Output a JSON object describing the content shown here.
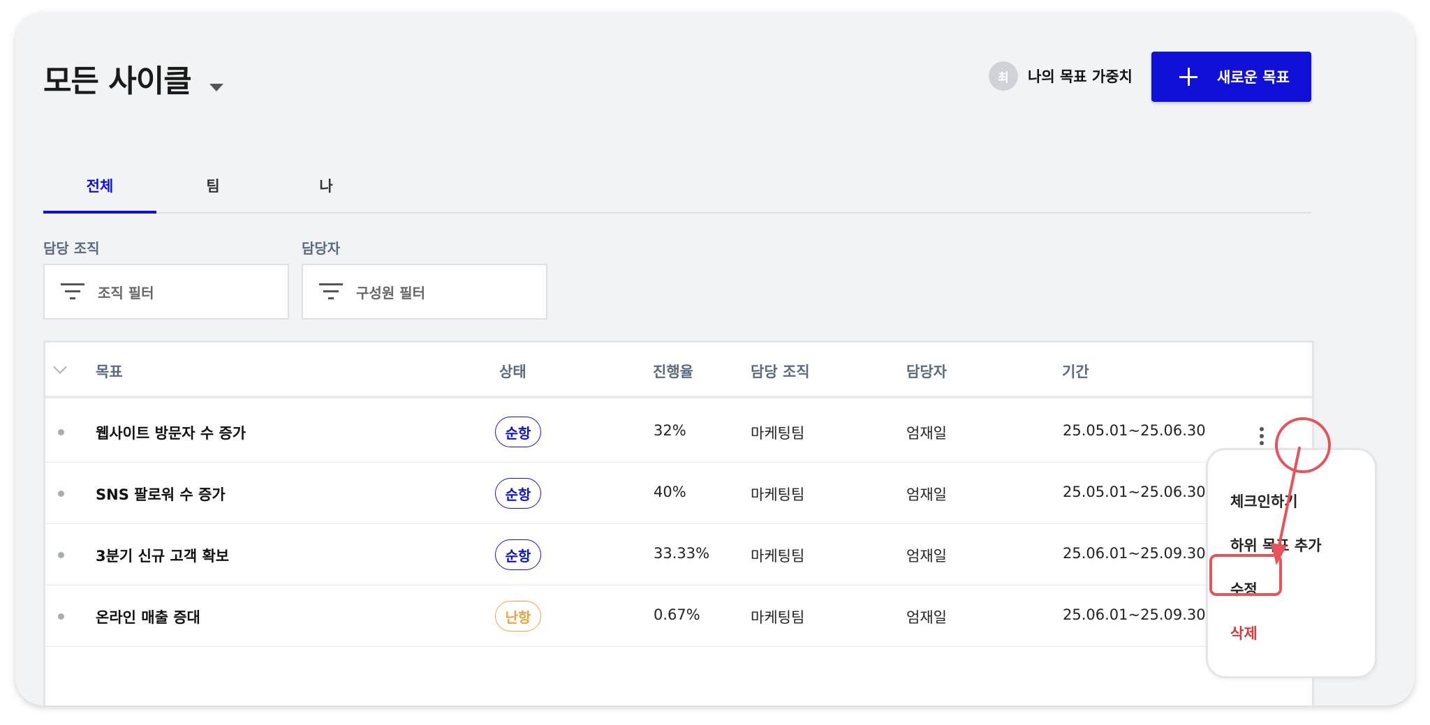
{
  "header": {
    "title": "모든 사이클",
    "avatar_initial": "최",
    "weight_label": "나의 목표 가중치",
    "new_goal_label": "새로운 목표"
  },
  "tabs": [
    {
      "label": "전체",
      "active": true
    },
    {
      "label": "팀",
      "active": false
    },
    {
      "label": "나",
      "active": false
    }
  ],
  "filters": {
    "org_label": "담당 조직",
    "org_placeholder": "조직 필터",
    "member_label": "담당자",
    "member_placeholder": "구성원 필터"
  },
  "table": {
    "headers": [
      "목표",
      "상태",
      "진행율",
      "담당 조직",
      "담당자",
      "기간"
    ],
    "rows": [
      {
        "goal": "웹사이트 방문자 수 증가",
        "status": "순항",
        "progress": "32%",
        "org": "마케팅팀",
        "owner": "엄재일",
        "period": "25.05.01~25.06.30"
      },
      {
        "goal": "SNS 팔로워 수 증가",
        "status": "순항",
        "progress": "40%",
        "org": "마케팅팀",
        "owner": "엄재일",
        "period": "25.05.01~25.06.30"
      },
      {
        "goal": "3분기 신규 고객 확보",
        "status": "순항",
        "progress": "33.33%",
        "org": "마케팅팀",
        "owner": "엄재일",
        "period": "25.06.01~25.09.30"
      },
      {
        "goal": "온라인 매출 증대",
        "status": "난항",
        "progress": "0.67%",
        "org": "마케팅팀",
        "owner": "엄재일",
        "period": "25.06.01~25.09.30"
      }
    ]
  },
  "context_menu": {
    "items": [
      "체크인하기",
      "하위 목표 추가",
      "수정",
      "삭제"
    ]
  },
  "colors": {
    "accent": "#1011d8",
    "status_ok": "#1011d8",
    "status_bad": "#f0a23a",
    "danger": "#d23b3b",
    "highlight": "#e8535a"
  },
  "icons": {
    "dropdown": "caret-down-icon",
    "add": "plus-icon",
    "filter": "filter-icon",
    "more": "kebab-icon"
  }
}
